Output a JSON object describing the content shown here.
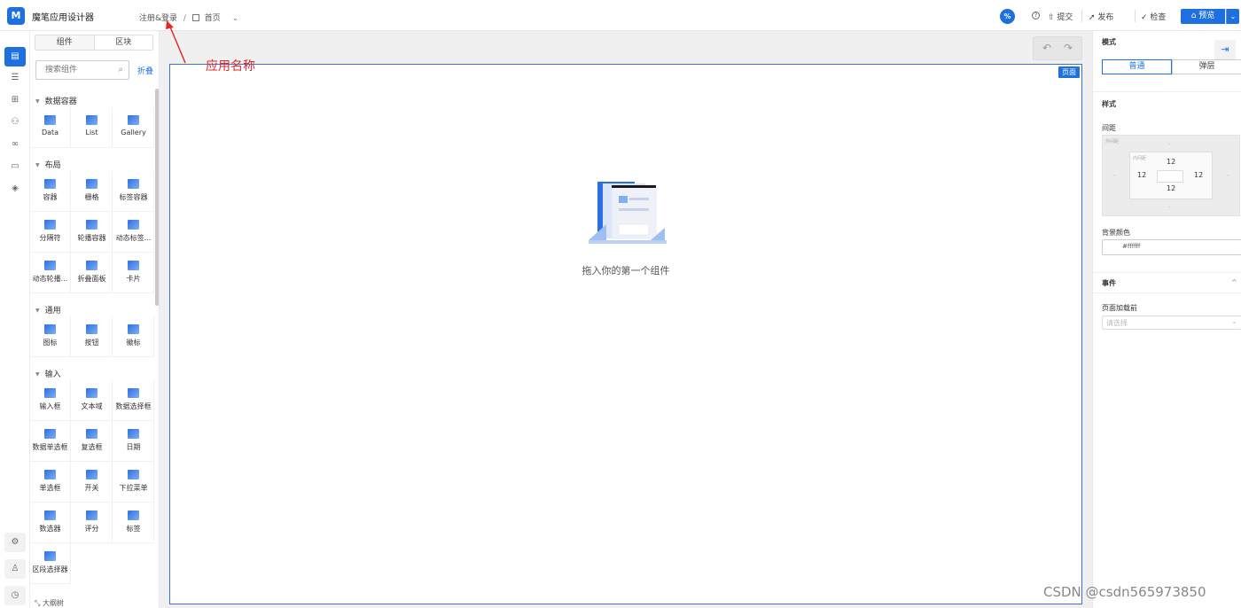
{
  "header": {
    "logo_text": "M",
    "app_title": "魔笔应用设计器",
    "breadcrumb": {
      "app_name": "注册&登录",
      "separator": "/",
      "page": "首页"
    },
    "percent_label": "%",
    "actions": {
      "help": "?",
      "submit": "提交",
      "publish": "发布",
      "check": "检查",
      "preview": "预览",
      "preview_dropdown": "⌄"
    }
  },
  "annotation": {
    "label": "应用名称",
    "color": "#e02a2a"
  },
  "left_panel": {
    "tabs": [
      "组件",
      "区块"
    ],
    "search_placeholder": "搜索组件",
    "collapse_label": "折叠",
    "categories": [
      {
        "name": "数据容器",
        "items": [
          "Data",
          "List",
          "Gallery"
        ]
      },
      {
        "name": "布局",
        "items": [
          "容器",
          "栅格",
          "标签容器",
          "分隔符",
          "轮播容器",
          "动态标签...",
          "动态轮播...",
          "折叠面板",
          "卡片"
        ]
      },
      {
        "name": "通用",
        "items": [
          "图标",
          "按钮",
          "徽标"
        ]
      },
      {
        "name": "输入",
        "items": [
          "输入框",
          "文本域",
          "数据选择框",
          "数据单选框",
          "复选框",
          "日期",
          "单选框",
          "开关",
          "下拉菜单",
          "数选器",
          "评分",
          "标签",
          "区段选择器"
        ]
      }
    ],
    "outline_label": "大纲树"
  },
  "canvas": {
    "page_tag": "页面",
    "empty_text": "拖入你的第一个组件",
    "undo": "↶",
    "redo": "↷"
  },
  "props": {
    "mode_label": "模式",
    "modes": [
      "普通",
      "弹层"
    ],
    "style_label": "样式",
    "spacing_label": "间距",
    "outer_label": "外间距",
    "inner_label": "内间距",
    "dash": "–",
    "padding": {
      "top": "12",
      "left": "12",
      "right": "12",
      "bottom": "12"
    },
    "bg_label": "背景颜色",
    "bg_value": "#ffffff",
    "events_label": "事件",
    "events_chevron": "^",
    "before_load_label": "页面加载前",
    "select_placeholder": "请选择",
    "expand_icon": "⇥"
  },
  "watermark": "CSDN @csdn565973850",
  "colors": {
    "primary": "#1e6fe0",
    "annotation": "#e02a2a"
  }
}
